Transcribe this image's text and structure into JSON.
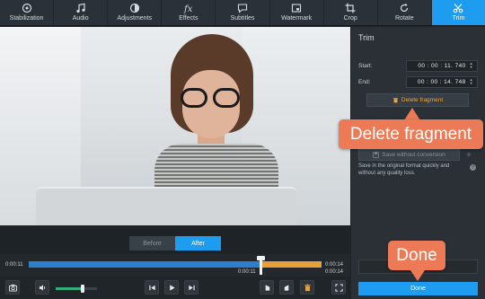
{
  "toolbar": {
    "items": [
      {
        "label": "Stabilization",
        "icon": "stabilization-icon"
      },
      {
        "label": "Audio",
        "icon": "music-note-icon"
      },
      {
        "label": "Adjustments",
        "icon": "contrast-icon"
      },
      {
        "label": "Effects",
        "icon": "fx-icon"
      },
      {
        "label": "Subtitles",
        "icon": "speech-bubble-icon"
      },
      {
        "label": "Watermark",
        "icon": "watermark-icon"
      },
      {
        "label": "Crop",
        "icon": "crop-icon"
      },
      {
        "label": "Rotate",
        "icon": "rotate-icon"
      },
      {
        "label": "Trim",
        "icon": "scissors-icon"
      }
    ],
    "active": "Trim"
  },
  "preview": {
    "before_label": "Before",
    "after_label": "After"
  },
  "timeline": {
    "current_time": "0:00:11",
    "end_time_top": "0:00:14",
    "selection_start": "0:00:11",
    "selection_end": "0:00:14",
    "playhead_fraction": 0.79,
    "selection_start_fraction": 0.795,
    "selection_end_fraction": 1.0
  },
  "controls": {
    "volume_fraction": 0.65
  },
  "panel": {
    "title": "Trim",
    "start_label": "Start:",
    "start_value": "00 : 00 : 11. 740",
    "end_label": "End:",
    "end_value": "00 : 00 : 14. 748",
    "delete_label": "Delete fragment",
    "save_label": "Save without conversion",
    "save_desc": "Save in the original format quickly and without any quality loss.",
    "done_label": "Done"
  },
  "callouts": {
    "delete": "Delete fragment",
    "done": "Done"
  },
  "colors": {
    "accent": "#1d9cf0",
    "callout": "#ec7a56",
    "selection": "#e8a13a",
    "delete_text": "#f0a43a"
  }
}
